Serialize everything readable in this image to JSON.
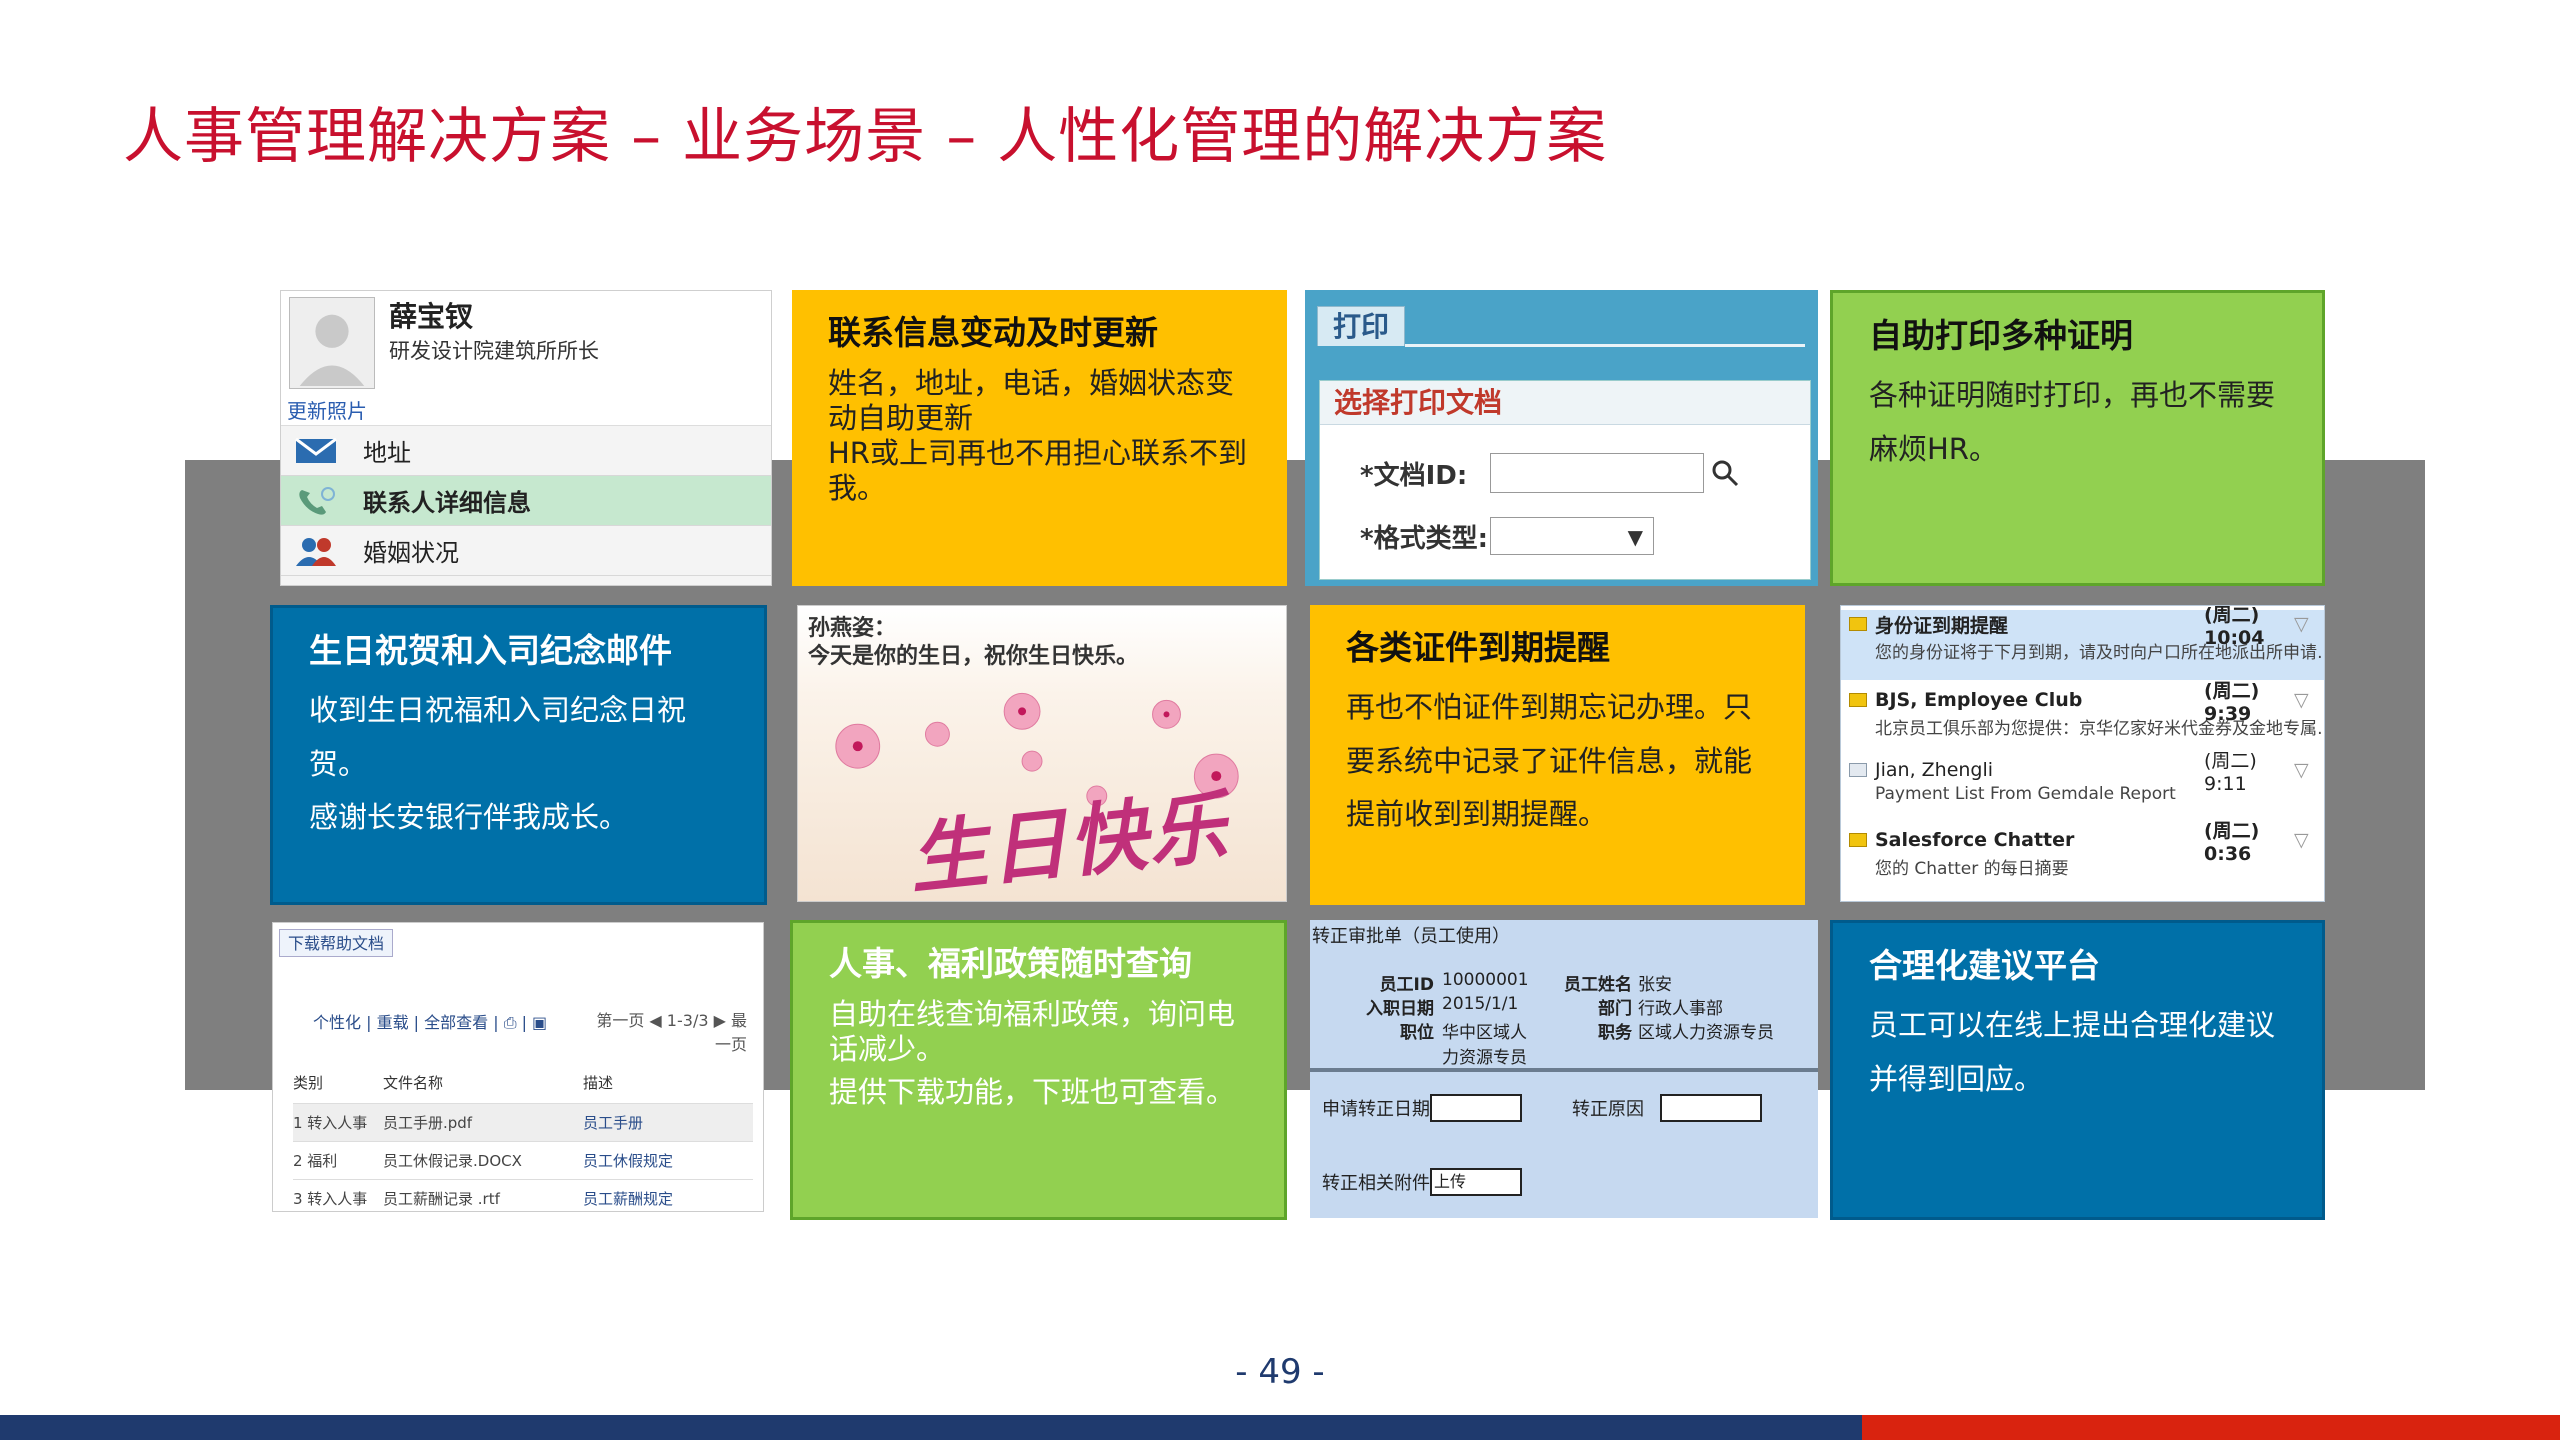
{
  "slide": {
    "title": "人事管理解决方案 – 业务场景 – 人性化管理的解决方案",
    "page_number": "- 49 -"
  },
  "contact_card": {
    "name": "薛宝钗",
    "position": "研发设计院建筑所所长",
    "update_photo": "更新照片",
    "rows": [
      {
        "label": "地址",
        "icon": "mail-icon"
      },
      {
        "label": "联系人详细信息",
        "icon": "phone-icon"
      },
      {
        "label": "婚姻状况",
        "icon": "people-icon"
      }
    ]
  },
  "tile_contact_update": {
    "title": "联系信息变动及时更新",
    "lines": [
      "姓名，地址，电话，婚姻状态变动自助更新",
      "HR或上司再也不用担心联系不到我。"
    ]
  },
  "print_form": {
    "tab": "打印",
    "panel_title": "选择打印文档",
    "doc_id_label": "*文档ID:",
    "format_label": "*格式类型:",
    "format_arrow": "▼"
  },
  "tile_print": {
    "title": "自助打印多种证明",
    "lines": [
      "各种证明随时打印，再也不需要麻烦HR。"
    ]
  },
  "tile_birthday": {
    "title": "生日祝贺和入司纪念邮件",
    "lines": [
      "收到生日祝福和入司纪念日祝贺。",
      "感谢长安银行伴我成长。"
    ]
  },
  "birthday_card": {
    "name": "孙燕姿：",
    "message": "今天是你的生日，祝你生日快乐。",
    "art_text": "生日快乐"
  },
  "tile_expiry": {
    "title": "各类证件到期提醒",
    "lines": [
      "再也不怕证件到期忘记办理。只要系统中记录了证件信息，就能提前收到到期提醒。"
    ]
  },
  "mail_list": {
    "items": [
      {
        "sender": "身份证到期提醒",
        "time": "(周二) 10:04",
        "preview": "您的身份证将于下月到期，请及时向户口所在地派出所申请…",
        "selected": true
      },
      {
        "sender": "BJS, Employee Club",
        "time": "(周二) 9:39",
        "preview": "北京员工俱乐部为您提供：京华亿家好米代金券及金地专属…",
        "selected": false
      },
      {
        "sender": "Jian, Zhengli",
        "time": "(周二) 9:11",
        "preview": "Payment List From  Gemdale  Report",
        "selected": false
      },
      {
        "sender": "Salesforce Chatter",
        "time": "(周二) 0:36",
        "preview": "您的 Chatter 的每日摘要",
        "selected": false
      }
    ]
  },
  "doc_list": {
    "tab": "下载帮助文档",
    "toolbar": "个性化 | 重载 | 全部查看 | ⎙ | ▣",
    "pager": "第一页 ◀ 1-3/3 ▶ 最一页",
    "columns": [
      "类别",
      "文件名称",
      "描述"
    ],
    "rows": [
      [
        "1 转入人事",
        "员工手册.pdf",
        "员工手册"
      ],
      [
        "2 福利",
        "员工休假记录.DOCX",
        "员工休假规定"
      ],
      [
        "3 转入人事",
        "员工薪酬记录  .rtf",
        "员工薪酬规定"
      ]
    ]
  },
  "tile_policy": {
    "title": "人事、福利政策随时查询",
    "lines": [
      "自助在线查询福利政策，询问电话减少。",
      "提供下载功能，下班也可查看。"
    ]
  },
  "regularization_form": {
    "title": "转正审批单（员工使用）",
    "fields": [
      {
        "k1": "员工ID",
        "v1": "10000001",
        "k2": "员工姓名",
        "v2": "张安"
      },
      {
        "k1": "入职日期",
        "v1": "2015/1/1",
        "k2": "部门",
        "v2": "行政人事部"
      },
      {
        "k1": "职位",
        "v1": "华中区域人力资源专员",
        "k2": "职务",
        "v2": "区域人力资源专员"
      }
    ],
    "apply_date_label": "申请转正日期",
    "reason_label": "转正原因",
    "attachment_label": "转正相关附件",
    "upload_label": "上传"
  },
  "tile_suggestion": {
    "title": "合理化建议平台",
    "lines": [
      "员工可以在线上提出合理化建议并得到回应。"
    ]
  },
  "colors": {
    "title_red": "#c8102e",
    "tile_yellow": "#ffc000",
    "tile_green": "#92d050",
    "tile_blue": "#0070a8",
    "band_gray": "#7f7f7f",
    "footer_blue": "#1f3a6e",
    "footer_red": "#d9230f"
  }
}
